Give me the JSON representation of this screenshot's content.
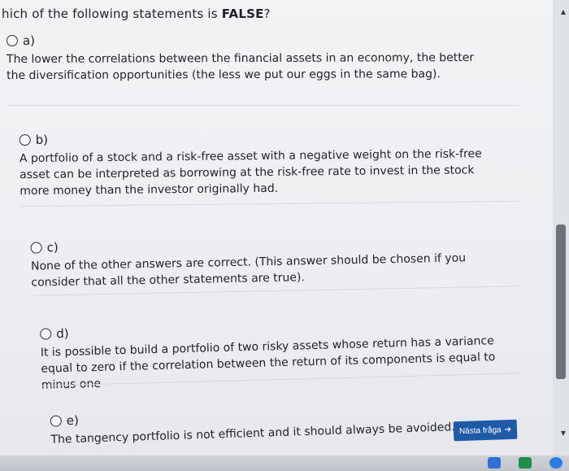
{
  "question": {
    "prefix": "hich of the following statements is ",
    "emphasis": "FALSE",
    "suffix": "?"
  },
  "options": [
    {
      "label": "a)",
      "text": "The lower the correlations between the financial assets in an economy, the better the diversification opportunities (the less we put our eggs in the same bag)."
    },
    {
      "label": "b)",
      "text": "A portfolio of a stock and a risk-free asset with a negative weight on the risk-free asset can be interpreted as borrowing at the risk-free rate to invest in the stock more money than the investor originally had."
    },
    {
      "label": "c)",
      "text": "None of the other answers are correct. (This answer should be chosen if you consider that all the other statements are true)."
    },
    {
      "label": "d)",
      "text": "It is possible to build a portfolio of two risky assets whose return has a variance equal to zero if the correlation between the return of its components is equal to minus one"
    },
    {
      "label": "e)",
      "text": "The tangency portfolio is not efficient and it should always be avoided."
    }
  ],
  "next_button": {
    "label": "Nästa fråga",
    "icon": "arrow-right-icon"
  },
  "colors": {
    "button": "#1f5aa8",
    "scroll_thumb": "#6e7279"
  }
}
